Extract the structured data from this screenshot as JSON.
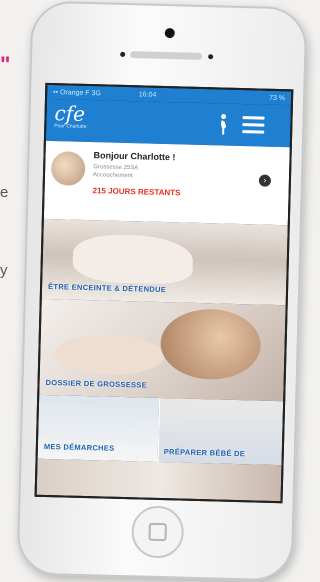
{
  "background": {
    "fragment_quote": "\"",
    "fragment_e": "e",
    "fragment_y": "y"
  },
  "colors": {
    "app_blue": "#1f7fd0",
    "days_red": "#e8301d",
    "label_blue": "#1d5fb0"
  },
  "statusbar": {
    "carrier": "•• Orange F 3G",
    "time": "16:04",
    "battery": "73 %"
  },
  "header": {
    "logo_script": "cfe",
    "logo_sub": "Pour Charlotte",
    "woman_icon": "pregnant-woman-icon",
    "menu_icon": "hamburger-menu-icon"
  },
  "welcome": {
    "greeting": "Bonjour Charlotte !",
    "info_line1": "Grossesse 25SA",
    "info_line2": "Accouchement",
    "days_remaining": "215 JOURS RESTANTS"
  },
  "tiles": [
    {
      "label": "ÊTRE ENCEINTE & DÉTENDUE"
    },
    {
      "label": "DOSSIER DE GROSSESSE"
    },
    {
      "label": "MES DÉMARCHES"
    },
    {
      "label": "PRÉPARER BÉBÉ DE"
    },
    {
      "label": ""
    }
  ]
}
